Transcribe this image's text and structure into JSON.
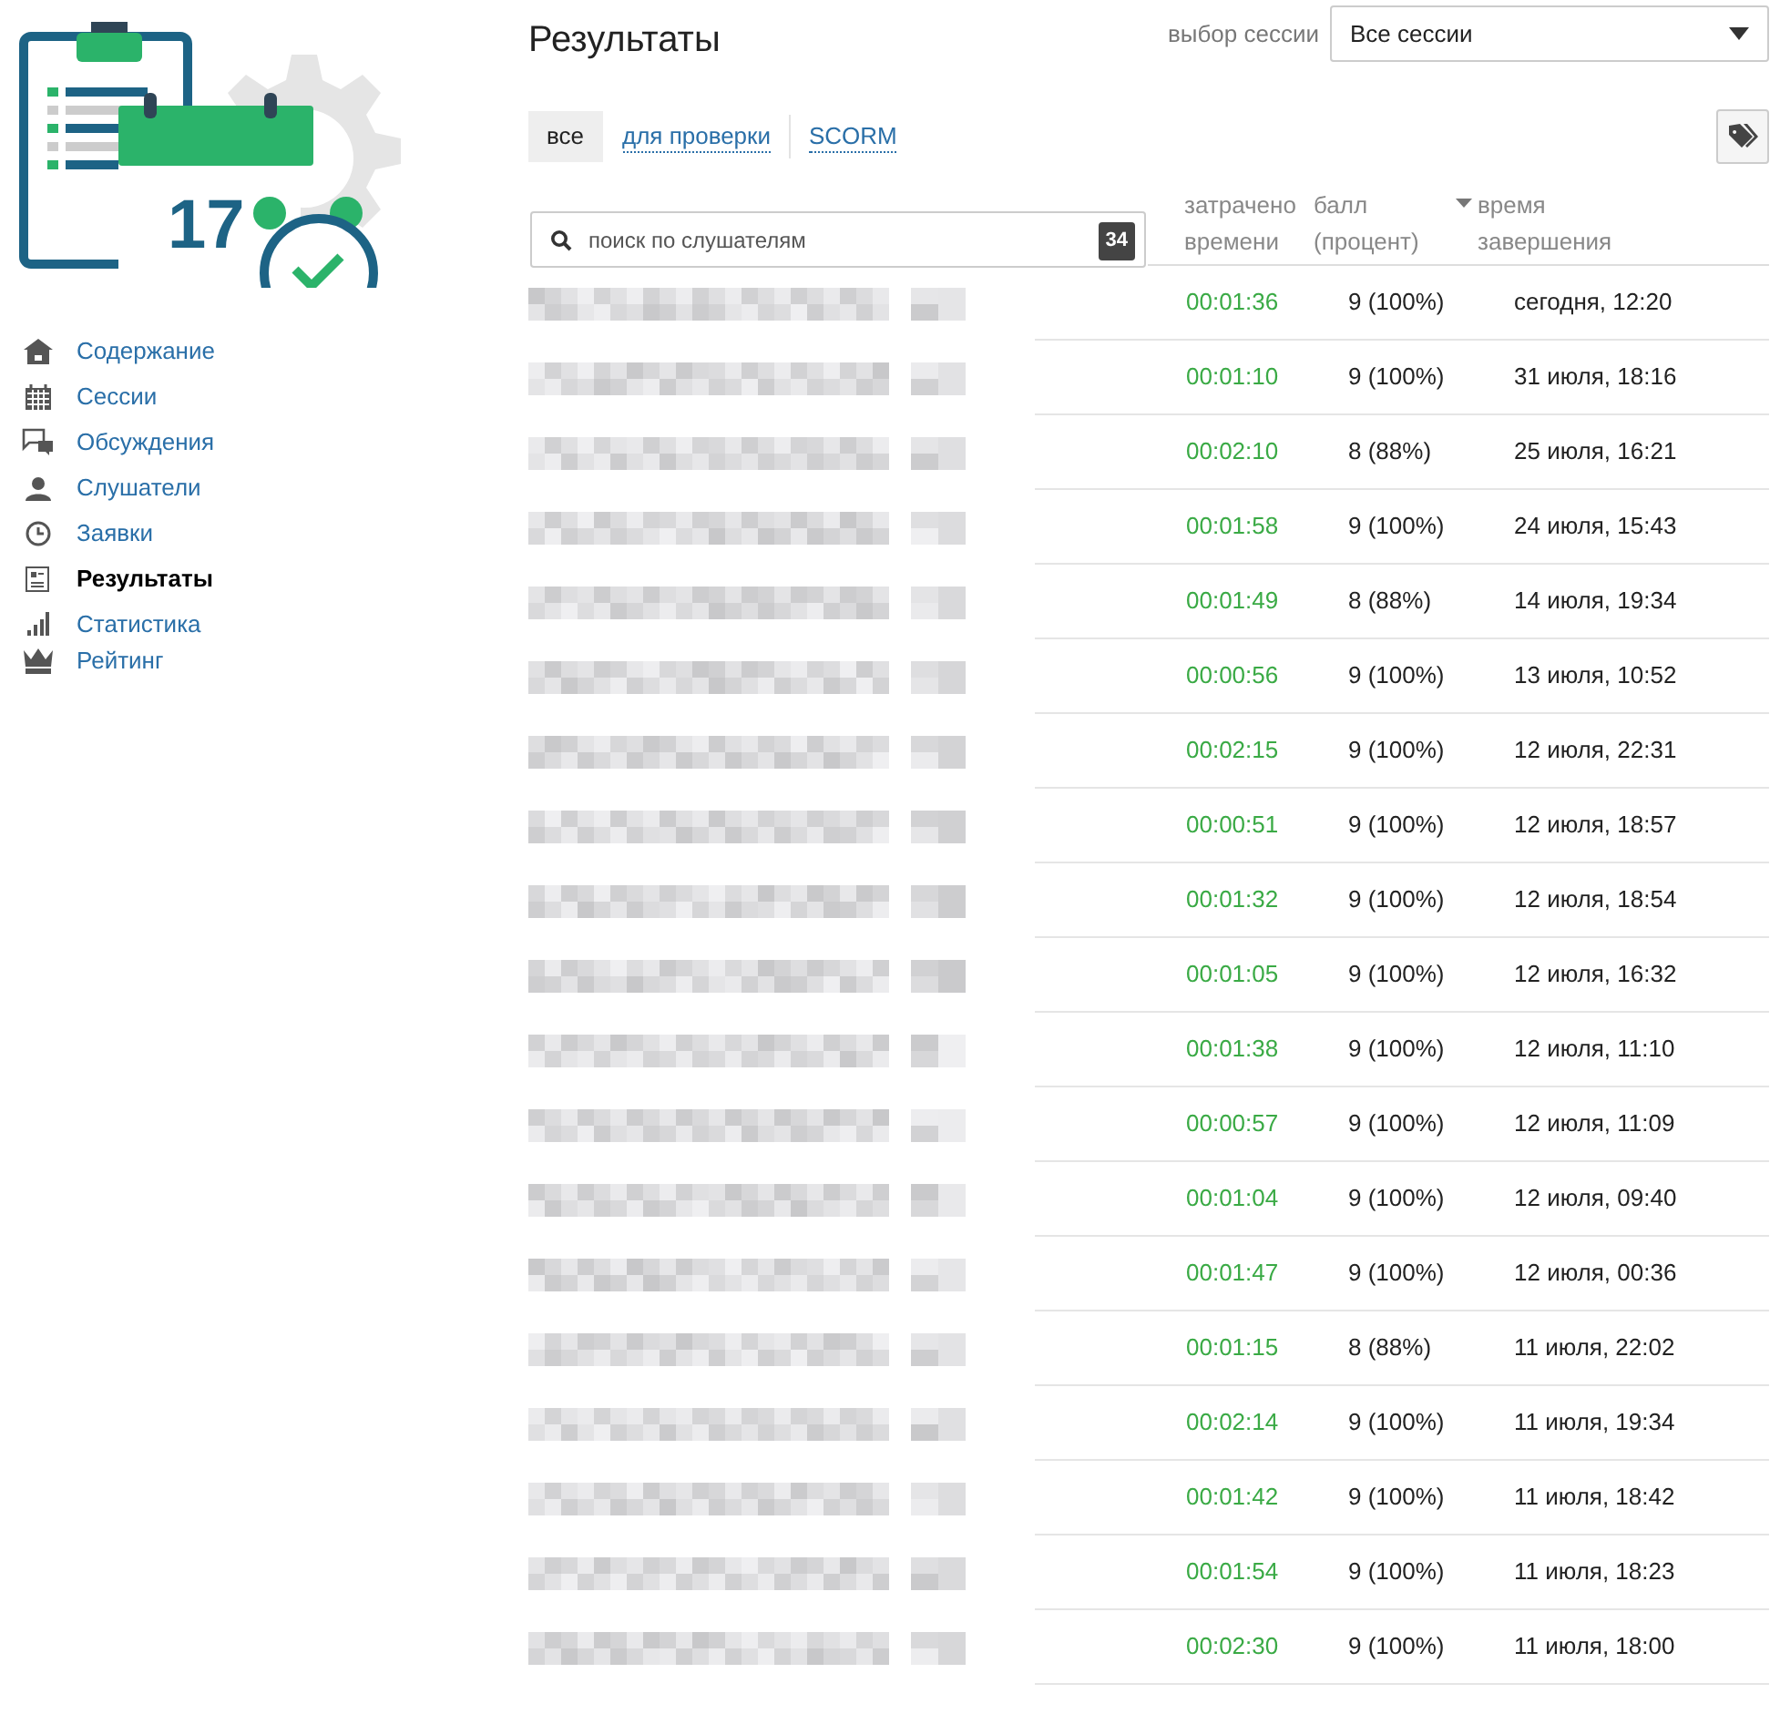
{
  "logo": {
    "calendar_day": "17"
  },
  "sidebar": {
    "items": [
      {
        "label": "Содержание",
        "selected": false
      },
      {
        "label": "Сессии",
        "selected": false
      },
      {
        "label": "Обсуждения",
        "selected": false
      },
      {
        "label": "Слушатели",
        "selected": false
      },
      {
        "label": "Заявки",
        "selected": false
      },
      {
        "label": "Результаты",
        "selected": true
      },
      {
        "label": "Статистика",
        "selected": false
      },
      {
        "label": "Рейтинг",
        "selected": false
      }
    ]
  },
  "page_title": "Результаты",
  "session_select": {
    "label": "выбор сессии",
    "value": "Все сессии"
  },
  "tabs": [
    {
      "label": "все",
      "selected": true
    },
    {
      "label": "для проверки",
      "selected": false
    },
    {
      "label": "SCORM",
      "selected": false
    }
  ],
  "search": {
    "placeholder": "поиск по слушателям",
    "count": "34"
  },
  "columns": [
    {
      "lines": [
        "затрачено",
        "времени"
      ],
      "sorted": false
    },
    {
      "lines": [
        "балл",
        "(процент)"
      ],
      "sorted": false
    },
    {
      "lines": [
        "время",
        "завершения"
      ],
      "sorted": true
    }
  ],
  "rows": [
    {
      "time": "00:01:36",
      "score": "9 (100%)",
      "finished": "сегодня, 12:20"
    },
    {
      "time": "00:01:10",
      "score": "9 (100%)",
      "finished": "31 июля, 18:16"
    },
    {
      "time": "00:02:10",
      "score": "8 (88%)",
      "finished": "25 июля, 16:21"
    },
    {
      "time": "00:01:58",
      "score": "9 (100%)",
      "finished": "24 июля, 15:43"
    },
    {
      "time": "00:01:49",
      "score": "8 (88%)",
      "finished": "14 июля, 19:34"
    },
    {
      "time": "00:00:56",
      "score": "9 (100%)",
      "finished": "13 июля, 10:52"
    },
    {
      "time": "00:02:15",
      "score": "9 (100%)",
      "finished": "12 июля, 22:31"
    },
    {
      "time": "00:00:51",
      "score": "9 (100%)",
      "finished": "12 июля, 18:57"
    },
    {
      "time": "00:01:32",
      "score": "9 (100%)",
      "finished": "12 июля, 18:54"
    },
    {
      "time": "00:01:05",
      "score": "9 (100%)",
      "finished": "12 июля, 16:32"
    },
    {
      "time": "00:01:38",
      "score": "9 (100%)",
      "finished": "12 июля, 11:10"
    },
    {
      "time": "00:00:57",
      "score": "9 (100%)",
      "finished": "12 июля, 11:09"
    },
    {
      "time": "00:01:04",
      "score": "9 (100%)",
      "finished": "12 июля, 09:40"
    },
    {
      "time": "00:01:47",
      "score": "9 (100%)",
      "finished": "12 июля, 00:36"
    },
    {
      "time": "00:01:15",
      "score": "8 (88%)",
      "finished": "11 июля, 22:02"
    },
    {
      "time": "00:02:14",
      "score": "9 (100%)",
      "finished": "11 июля, 19:34"
    },
    {
      "time": "00:01:42",
      "score": "9 (100%)",
      "finished": "11 июля, 18:42"
    },
    {
      "time": "00:01:54",
      "score": "9 (100%)",
      "finished": "11 июля, 18:23"
    },
    {
      "time": "00:02:30",
      "score": "9 (100%)",
      "finished": "11 июля, 18:00"
    }
  ]
}
